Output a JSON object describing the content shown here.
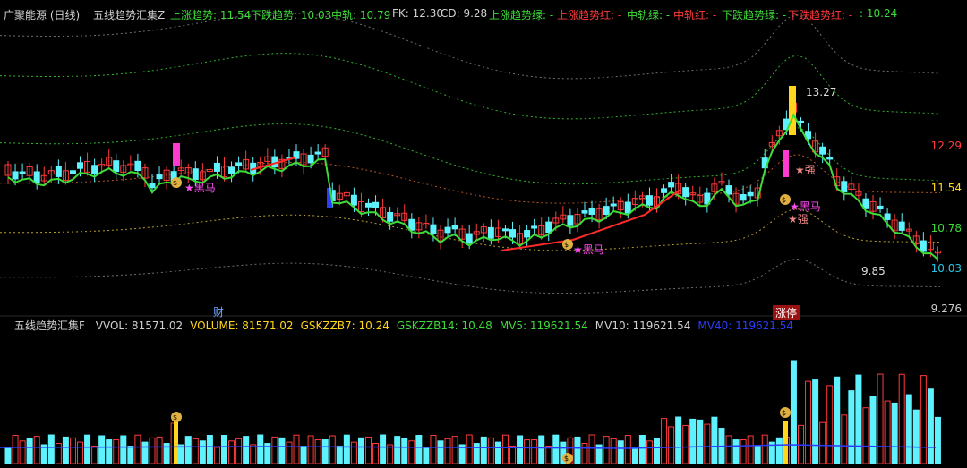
{
  "top": {
    "stock": "广聚能源 (日线)",
    "indicator": "五线趋势汇集Z",
    "values": [
      {
        "label": "上涨趋势: 11.54",
        "color": "#3ddc38"
      },
      {
        "label": "下跌趋势: 10.03",
        "color": "#3ddc38"
      },
      {
        "label": "中轨: 10.79",
        "color": "#3ddc38"
      },
      {
        "label": "FK: 12.30",
        "color": "#d0d0d0"
      },
      {
        "label": "CD: 9.28",
        "color": "#d0d0d0"
      },
      {
        "label": "上涨趋势绿: -",
        "color": "#3ddc38"
      },
      {
        "label": "上涨趋势红: -",
        "color": "#ff3838"
      },
      {
        "label": "中轨绿: -",
        "color": "#3ddc38"
      },
      {
        "label": "中轨红: -",
        "color": "#ff3838"
      },
      {
        "label": "下跌趋势绿: -",
        "color": "#3ddc38"
      },
      {
        "label": "下跌趋势红: -",
        "color": "#ff3838"
      },
      {
        "label": ": 10.24",
        "color": "#3ddc38"
      }
    ]
  },
  "price_axis": [
    {
      "label": "12.29",
      "color": "#ff3b3b"
    },
    {
      "label": "11.54",
      "color": "#ffd51e"
    },
    {
      "label": "10.78",
      "color": "#3ddc38"
    },
    {
      "label": "10.03",
      "color": "#27c6e6"
    },
    {
      "label": "9.276",
      "color": "#cccccc"
    }
  ],
  "annotations": {
    "high": "13.27",
    "low": "9.85",
    "heima": "黑马",
    "qiang": "强",
    "cai": "财",
    "zhangting": "涨停"
  },
  "volume": {
    "indicator": "五线趋势汇集F",
    "items": [
      {
        "label": "VVOL: 81571.02",
        "color": "#d0d0d0"
      },
      {
        "label": "VOLUME: 81571.02",
        "color": "#ffd51e"
      },
      {
        "label": "GSKZZB7: 10.24",
        "color": "#ffd51e"
      },
      {
        "label": "GSKZZB14: 10.48",
        "color": "#3ddc38"
      },
      {
        "label": "MV5: 119621.54",
        "color": "#3ddc38"
      },
      {
        "label": "MV10: 119621.54",
        "color": "#d0d0d0"
      },
      {
        "label": "MV40: 119621.54",
        "color": "#2b3cff"
      }
    ]
  }
}
